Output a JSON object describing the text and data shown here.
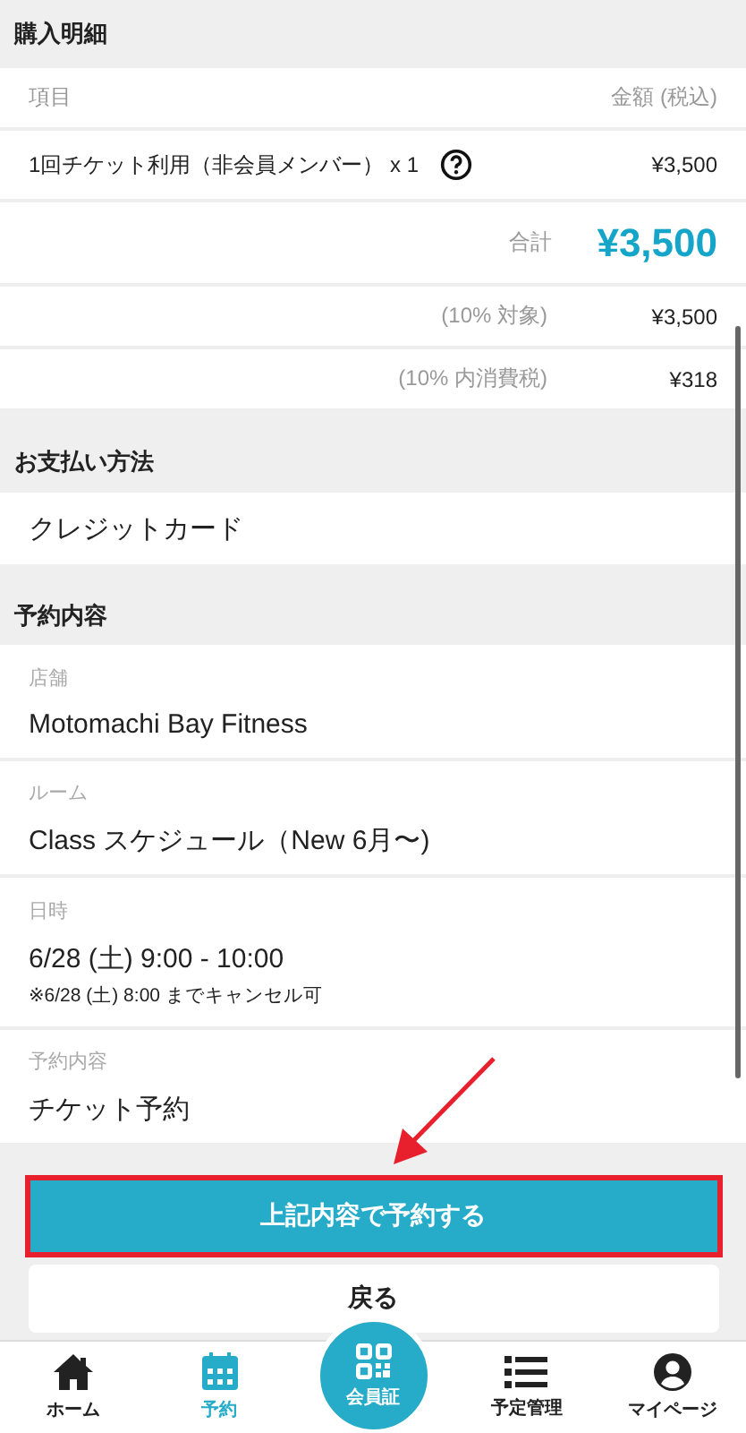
{
  "purchase": {
    "title": "購入明細",
    "col_item": "項目",
    "col_amount": "金額 (税込)",
    "items": [
      {
        "name": "1回チケット利用（非会員メンバー） x 1",
        "amount": "¥3,500"
      }
    ],
    "total_label": "合計",
    "total": "¥3,500",
    "tax_rows": [
      {
        "label": "(10% 対象)",
        "amount": "¥3,500"
      },
      {
        "label": "(10% 内消費税)",
        "amount": "¥318"
      }
    ]
  },
  "payment": {
    "title": "お支払い方法",
    "method": "クレジットカード"
  },
  "reservation": {
    "title": "予約内容",
    "fields": [
      {
        "label": "店舗",
        "value": "Motomachi Bay Fitness"
      },
      {
        "label": "ルーム",
        "value": "Class スケジュール（New 6月〜)"
      },
      {
        "label": "日時",
        "value": "6/28 (土) 9:00 - 10:00",
        "note": "※6/28 (土) 8:00 までキャンセル可"
      },
      {
        "label": "予約内容",
        "value": "チケット予約"
      }
    ]
  },
  "buttons": [
    {
      "label": "上記内容で予約する",
      "kind": "primary",
      "highlighted": true
    },
    {
      "label": "戻る",
      "kind": "secondary",
      "highlighted": false
    }
  ],
  "tabs": [
    {
      "label": "ホーム",
      "kind": "home",
      "selected": false
    },
    {
      "label": "予約",
      "kind": "calendar",
      "selected": true
    },
    {
      "label": "会員証",
      "kind": "qr",
      "selected": false
    },
    {
      "label": "予定管理",
      "kind": "list",
      "selected": false
    },
    {
      "label": "マイページ",
      "kind": "user",
      "selected": false
    }
  ]
}
